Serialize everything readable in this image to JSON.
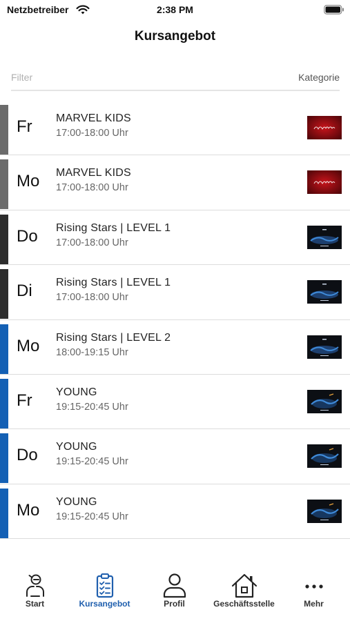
{
  "status_bar": {
    "carrier": "Netzbetreiber",
    "time": "2:38 PM"
  },
  "header": {
    "title": "Kursangebot"
  },
  "filter": {
    "placeholder": "Filter",
    "category_label": "Kategorie"
  },
  "courses": [
    {
      "day": "Fr",
      "name": "MARVEL KIDS",
      "time": "17:00-18:00 Uhr",
      "stripe_color": "#6b6b6b",
      "thumbnail": "marvel-kids-thumbnail"
    },
    {
      "day": "Mo",
      "name": "MARVEL KIDS",
      "time": "17:00-18:00 Uhr",
      "stripe_color": "#6b6b6b",
      "thumbnail": "marvel-kids-thumbnail"
    },
    {
      "day": "Do",
      "name": "Rising Stars | LEVEL 1",
      "time": "17:00-18:00 Uhr",
      "stripe_color": "#2d2d2d",
      "thumbnail": "rising-stars-thumbnail"
    },
    {
      "day": "Di",
      "name": "Rising Stars | LEVEL 1",
      "time": "17:00-18:00 Uhr",
      "stripe_color": "#2d2d2d",
      "thumbnail": "rising-stars-thumbnail"
    },
    {
      "day": "Mo",
      "name": "Rising Stars | LEVEL 2",
      "time": "18:00-19:15 Uhr",
      "stripe_color": "#1460b4",
      "thumbnail": "rising-stars-thumbnail"
    },
    {
      "day": "Fr",
      "name": "YOUNG",
      "time": "19:15-20:45 Uhr",
      "stripe_color": "#1460b4",
      "thumbnail": "young-thumbnail"
    },
    {
      "day": "Do",
      "name": "YOUNG",
      "time": "19:15-20:45 Uhr",
      "stripe_color": "#1460b4",
      "thumbnail": "young-thumbnail"
    },
    {
      "day": "Mo",
      "name": "YOUNG",
      "time": "19:15-20:45 Uhr",
      "stripe_color": "#1460b4",
      "thumbnail": "young-thumbnail"
    }
  ],
  "tab_bar": {
    "active_color": "#1f5fae",
    "tabs": [
      {
        "label": "Start",
        "icon": "start-icon"
      },
      {
        "label": "Kursangebot",
        "icon": "clipboard-list-icon",
        "active": true
      },
      {
        "label": "Profil",
        "icon": "person-icon"
      },
      {
        "label": "Geschäftsstelle",
        "icon": "house-icon"
      },
      {
        "label": "Mehr",
        "icon": "more-dots-icon"
      }
    ]
  }
}
